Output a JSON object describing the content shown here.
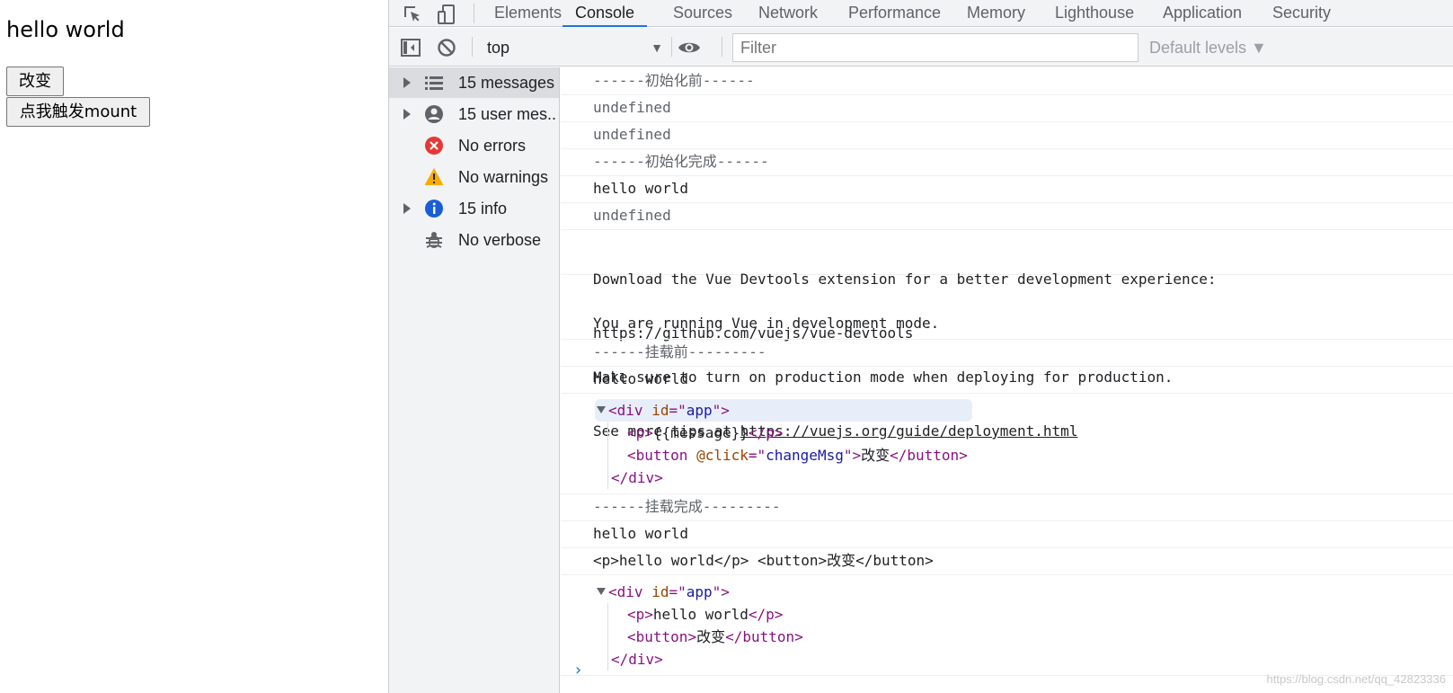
{
  "page": {
    "heading": "hello world",
    "buttons": {
      "change": "改变",
      "mount": "点我触发mount"
    }
  },
  "devtools": {
    "tabs": [
      "Elements",
      "Console",
      "Sources",
      "Network",
      "Performance",
      "Memory",
      "Lighthouse",
      "Application",
      "Security"
    ],
    "active_tab": "Console",
    "toolbar": {
      "context": "top",
      "filter_placeholder": "Filter",
      "levels": "Default levels ▼"
    },
    "sidebar": [
      {
        "label": "15 messages",
        "icon": "list-icon",
        "expandable": true,
        "selected": true
      },
      {
        "label": "15 user mes...",
        "icon": "user-icon",
        "expandable": true
      },
      {
        "label": "No errors",
        "icon": "error-icon"
      },
      {
        "label": "No warnings",
        "icon": "warning-icon"
      },
      {
        "label": "15 info",
        "icon": "info-icon",
        "expandable": true
      },
      {
        "label": "No verbose",
        "icon": "bug-icon"
      }
    ],
    "messages": {
      "m1": "------初始化前------",
      "m2": "undefined",
      "m3": "undefined",
      "m4": "------初始化完成------",
      "m5": "hello world",
      "m6": "undefined",
      "m7_line1": "Download the Vue Devtools extension for a better development experience:",
      "m7_link": "https://github.com/vuejs/vue-devtools",
      "m8_line1": "You are running Vue in development mode.",
      "m8_line2": "Make sure to turn on production mode when deploying for production.",
      "m8_line3": "See more tips at ",
      "m8_link": "https://vuejs.org/guide/deployment.html",
      "m9": "------挂载前---------",
      "m10": "hello world",
      "tree1": {
        "open": "div",
        "attr": "id",
        "value": "app",
        "child1_tag": "p",
        "child1_text": "{{message}}",
        "child2_tag": "button",
        "child2_attr": "@click",
        "child2_value": "changeMsg",
        "child2_text": "改变",
        "close": "div"
      },
      "m11": "------挂载完成---------",
      "m12": "hello world",
      "m13": "<p>hello world</p> <button>改变</button>",
      "tree2": {
        "open": "div",
        "attr": "id",
        "value": "app",
        "child1_tag": "p",
        "child1_text": "hello world",
        "child2_tag": "button",
        "child2_text": "改变",
        "close": "div"
      }
    },
    "prompt": "›",
    "watermark": "https://blog.csdn.net/qq_42823336"
  }
}
